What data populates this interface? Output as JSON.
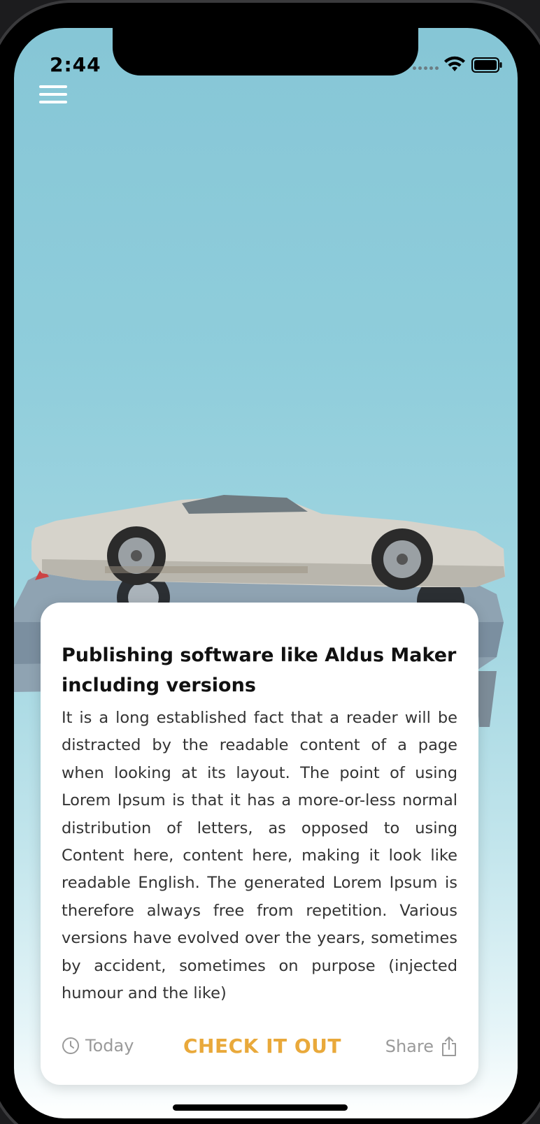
{
  "status_bar": {
    "time": "2:44"
  },
  "nav": {
    "menu_icon": "hamburger-menu-icon"
  },
  "article": {
    "title": "Publishing software like Aldus Maker including versions",
    "body": "It is a long established fact that a reader will be distracted by the readable content of a page when looking at its layout. The point of using Lorem Ipsum is that it has a more-or-less normal distribution of letters, as opposed to using Content here, content here, making it look like readable English. The generated Lorem Ipsum is therefore always free from repetition. Various versions have evolved over the years, sometimes by accident, sometimes on purpose (injected humour and the like)",
    "date_label": "Today",
    "cta_label": "CHECK IT OUT",
    "share_label": "Share"
  },
  "colors": {
    "accent": "#e9a93b",
    "sky_top": "#86c6d6",
    "muted_text": "#9a9a9a"
  }
}
